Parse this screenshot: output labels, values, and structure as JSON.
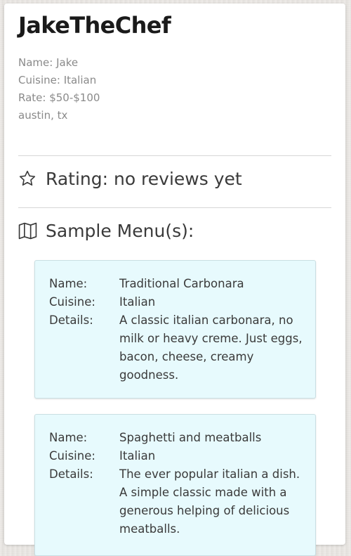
{
  "profile": {
    "title": "JakeTheChef",
    "name": "Name: Jake",
    "cuisine": "Cuisine: Italian",
    "rate": "Rate: $50-$100",
    "location": "austin, tx"
  },
  "rating": {
    "icon": "star-outline-icon",
    "label": "Rating: no reviews yet"
  },
  "menus": {
    "icon": "map-icon",
    "heading": "Sample Menu(s):",
    "labels": {
      "name": "Name:",
      "cuisine": "Cuisine:",
      "details": "Details:"
    },
    "items": [
      {
        "name": "Traditional Carbonara",
        "cuisine": "Italian",
        "details": "A classic italian carbonara, no milk or heavy creme. Just eggs, bacon, cheese, creamy goodness."
      },
      {
        "name": "Spaghetti and meatballs",
        "cuisine": "Italian",
        "details": "The ever popular italian a dish. A simple classic made with a generous helping of delicious meatballs."
      }
    ]
  },
  "colors": {
    "menu_card_bg": "#e7fafd",
    "card_bg": "#ffffff",
    "text_muted": "#8a8a8a"
  }
}
